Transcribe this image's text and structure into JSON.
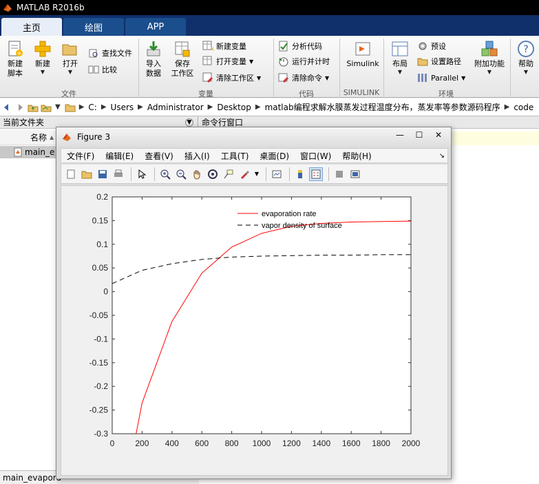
{
  "window": {
    "title": "MATLAB R2016b"
  },
  "tabs": [
    {
      "label": "主页",
      "active": true
    },
    {
      "label": "绘图",
      "active": false
    },
    {
      "label": "APP",
      "active": false
    }
  ],
  "ribbon": {
    "file": {
      "new_script": [
        "新建",
        "脚本"
      ],
      "new": "新建",
      "open": "打开",
      "find_files": "查找文件",
      "compare": "比较",
      "group_label": "文件"
    },
    "variable": {
      "import": [
        "导入",
        "数据"
      ],
      "save": [
        "保存",
        "工作区"
      ],
      "new_var": "新建变量",
      "open_var": "打开变量",
      "clear_ws": "清除工作区",
      "group_label": "变量"
    },
    "code": {
      "analyze": "分析代码",
      "run_time": "运行并计时",
      "clear_cmd": "清除命令",
      "group_label": "代码"
    },
    "simulink": {
      "label": "Simulink",
      "group_label": "SIMULINK"
    },
    "env": {
      "layout": "布局",
      "prefs": "预设",
      "set_path": "设置路径",
      "parallel": "Parallel",
      "addons": "附加功能",
      "group_label": "环境"
    },
    "help": "帮助"
  },
  "address": {
    "crumbs": [
      "C:",
      "Users",
      "Administrator",
      "Desktop",
      "matlab编程求解水膜蒸发过程温度分布，蒸发率等参数源码程序",
      "code"
    ]
  },
  "left_panel": {
    "title": "当前文件夹",
    "col_name": "名称",
    "sort_arrow": "▲",
    "file": "main_e",
    "status": "main_evapora"
  },
  "right_panel": {
    "title": "命令行窗口"
  },
  "figure": {
    "title": "Figure 3",
    "menu": [
      "文件(F)",
      "编辑(E)",
      "查看(V)",
      "插入(I)",
      "工具(T)",
      "桌面(D)",
      "窗口(W)",
      "帮助(H)"
    ]
  },
  "chart_data": {
    "type": "line",
    "title": "",
    "xlabel": "",
    "ylabel": "",
    "xlim": [
      0,
      2000
    ],
    "ylim": [
      -0.3,
      0.2
    ],
    "xticks": [
      0,
      200,
      400,
      600,
      800,
      1000,
      1200,
      1400,
      1600,
      1800,
      2000
    ],
    "yticks": [
      -0.3,
      -0.25,
      -0.2,
      -0.15,
      -0.1,
      -0.05,
      0,
      0.05,
      0.1,
      0.15,
      0.2
    ],
    "legend_position": "top-right",
    "series": [
      {
        "name": "evaporation rate",
        "color": "#ff0000",
        "dash": "solid",
        "x": [
          160,
          200,
          400,
          600,
          800,
          1000,
          1200,
          1400,
          1600,
          1800,
          2000
        ],
        "y": [
          -0.3,
          -0.235,
          -0.063,
          0.039,
          0.094,
          0.123,
          0.138,
          0.144,
          0.147,
          0.148,
          0.149
        ]
      },
      {
        "name": "vapor density of surface",
        "color": "#000000",
        "dash": "dashed",
        "x": [
          0,
          200,
          400,
          600,
          800,
          1000,
          1200,
          1400,
          1600,
          1800,
          2000
        ],
        "y": [
          0.017,
          0.045,
          0.059,
          0.068,
          0.073,
          0.075,
          0.076,
          0.077,
          0.077,
          0.078,
          0.078
        ]
      }
    ]
  }
}
